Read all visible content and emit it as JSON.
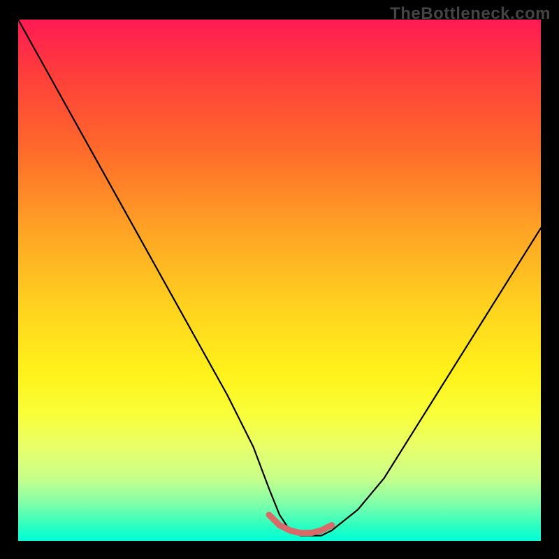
{
  "watermark": "TheBottleneck.com",
  "chart_data": {
    "type": "line",
    "title": "",
    "xlabel": "",
    "ylabel": "",
    "xlim": [
      0,
      100
    ],
    "ylim": [
      0,
      100
    ],
    "x": [
      0,
      5,
      10,
      15,
      20,
      25,
      30,
      35,
      40,
      45,
      48,
      50,
      52,
      54,
      56,
      58,
      60,
      65,
      70,
      75,
      80,
      85,
      90,
      95,
      100
    ],
    "values": [
      100,
      91,
      82,
      73,
      64,
      55,
      46,
      37,
      28,
      18,
      10,
      5,
      2,
      1,
      1,
      1,
      2,
      6,
      12,
      20,
      28,
      36,
      44,
      52,
      60
    ],
    "annotation_segment": {
      "x": [
        48,
        50,
        52,
        54,
        56,
        58,
        60
      ],
      "values": [
        5,
        3,
        2,
        1.5,
        1.5,
        2,
        3
      ],
      "color": "#d86a6a",
      "note": "highlighted minimum region"
    }
  },
  "colors": {
    "curve": "#000000",
    "highlight": "#d86a6a",
    "frame_bg": "#000000"
  }
}
